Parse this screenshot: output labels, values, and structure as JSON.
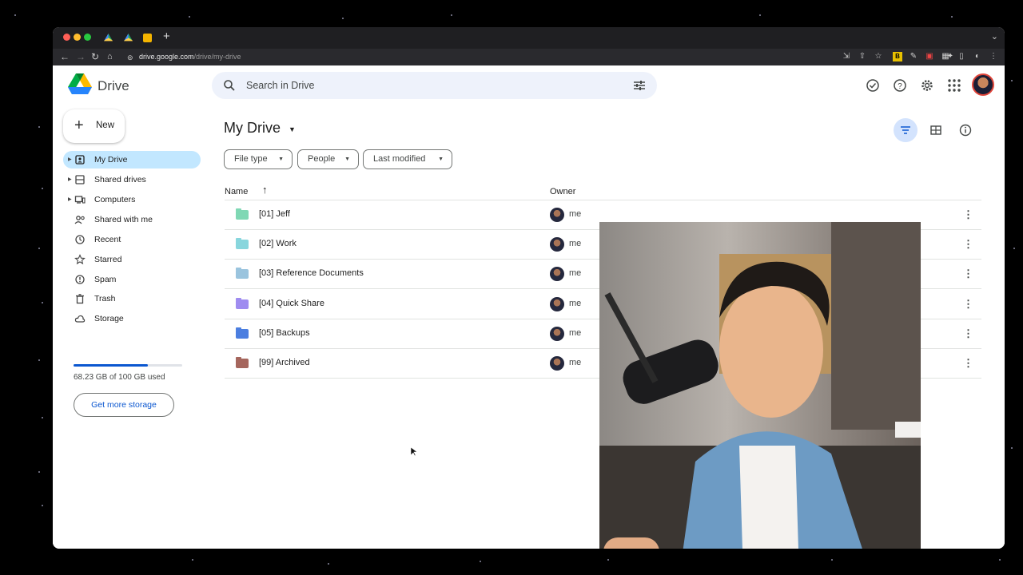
{
  "browser": {
    "url_host": "drive.google.com",
    "url_path": "/drive/my-drive"
  },
  "app": {
    "name": "Drive",
    "search_placeholder": "Search in Drive"
  },
  "sidebar": {
    "new_label": "New",
    "items": [
      {
        "label": "My Drive",
        "icon": "my-drive-icon",
        "active": true,
        "expandable": true
      },
      {
        "label": "Shared drives",
        "icon": "shared-drives-icon",
        "active": false,
        "expandable": true
      },
      {
        "label": "Computers",
        "icon": "computers-icon",
        "active": false,
        "expandable": true
      },
      {
        "label": "Shared with me",
        "icon": "shared-with-me-icon",
        "active": false,
        "expandable": false
      },
      {
        "label": "Recent",
        "icon": "clock-icon",
        "active": false,
        "expandable": false
      },
      {
        "label": "Starred",
        "icon": "star-icon",
        "active": false,
        "expandable": false
      },
      {
        "label": "Spam",
        "icon": "spam-icon",
        "active": false,
        "expandable": false
      },
      {
        "label": "Trash",
        "icon": "trash-icon",
        "active": false,
        "expandable": false
      },
      {
        "label": "Storage",
        "icon": "cloud-icon",
        "active": false,
        "expandable": false
      }
    ],
    "storage": {
      "used_fraction": 0.6823,
      "text": "68.23 GB of 100 GB used",
      "button": "Get more storage"
    }
  },
  "main": {
    "title": "My Drive",
    "filters": [
      "File type",
      "People",
      "Last modified"
    ],
    "columns": {
      "name": "Name",
      "owner": "Owner"
    },
    "rows": [
      {
        "name": "[01] Jeff",
        "owner": "me",
        "color": "#7fd8b4"
      },
      {
        "name": "[02] Work",
        "owner": "me",
        "color": "#88d6dd"
      },
      {
        "name": "[03] Reference Documents",
        "owner": "me",
        "color": "#9ac4de"
      },
      {
        "name": "[04] Quick Share",
        "owner": "me",
        "color": "#9f8cf0"
      },
      {
        "name": "[05] Backups",
        "owner": "me",
        "color": "#4b7ee0"
      },
      {
        "name": "[99] Archived",
        "owner": "me",
        "color": "#a5665d"
      }
    ]
  },
  "colors": {
    "accent": "#0b57d0",
    "nav_active": "#c2e7ff",
    "search_bg": "#eef2fb"
  }
}
